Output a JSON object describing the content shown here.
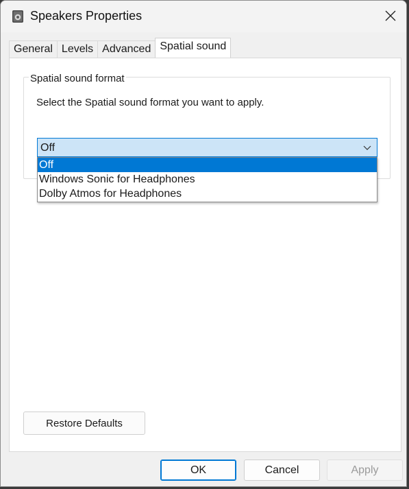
{
  "window": {
    "title": "Speakers Properties",
    "icons": {
      "app": "speaker-icon",
      "close": "close-icon"
    }
  },
  "tabs": [
    {
      "label": "General",
      "active": false
    },
    {
      "label": "Levels",
      "active": false
    },
    {
      "label": "Advanced",
      "active": false
    },
    {
      "label": "Spatial sound",
      "active": true
    }
  ],
  "spatial": {
    "group_title": "Spatial sound format",
    "description": "Select the Spatial sound format you want to apply.",
    "selected_value": "Off",
    "options": [
      {
        "label": "Off",
        "selected": true
      },
      {
        "label": "Windows Sonic for Headphones",
        "selected": false
      },
      {
        "label": "Dolby Atmos for Headphones",
        "selected": false
      }
    ],
    "restore_label": "Restore Defaults"
  },
  "footer": {
    "ok_label": "OK",
    "cancel_label": "Cancel",
    "apply_label": "Apply",
    "apply_enabled": false
  },
  "colors": {
    "accent": "#0078d4",
    "select_bg": "#cce4f7",
    "disabled_text": "#9a9a9a"
  }
}
